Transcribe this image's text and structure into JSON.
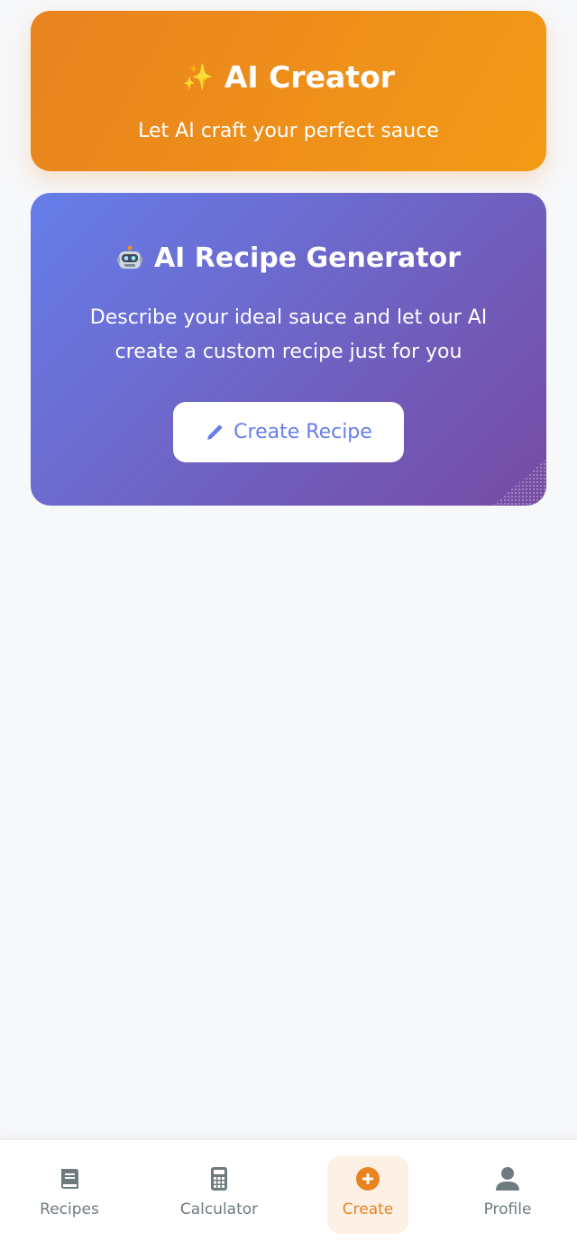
{
  "hero": {
    "title": "AI Creator",
    "subtitle": "Let AI craft your perfect sauce",
    "icon": "sparkles-icon"
  },
  "generator": {
    "title": "AI Recipe Generator",
    "description": "Describe your ideal sauce and let our AI create a custom recipe just for you",
    "button_label": "Create Recipe",
    "icon": "robot-icon",
    "button_icon": "pencil-icon"
  },
  "tabs": [
    {
      "label": "Recipes",
      "icon": "book-icon",
      "active": false
    },
    {
      "label": "Calculator",
      "icon": "calculator-icon",
      "active": false
    },
    {
      "label": "Create",
      "icon": "plus-circle-icon",
      "active": true
    },
    {
      "label": "Profile",
      "icon": "user-icon",
      "active": false
    }
  ],
  "colors": {
    "accent": "#e8831f",
    "hero_gradient_start": "#e8831f",
    "hero_gradient_end": "#f39a16",
    "card_gradient_start": "#667eea",
    "card_gradient_end": "#764ba2",
    "inactive": "#6d7a80"
  }
}
